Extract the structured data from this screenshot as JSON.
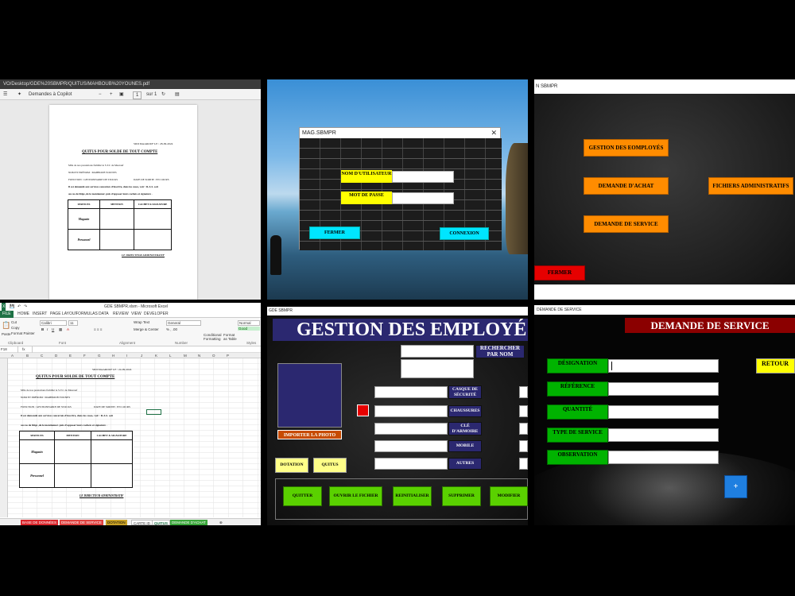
{
  "pdf_viewer": {
    "path": "VO/Desktop/GDE%20SBMPR/QUITUS/MAHBOUB%20YOUNES.pdf",
    "toolbar": {
      "ask_copilot": "Demandes à Copilot",
      "minus": "−",
      "plus": "+",
      "page_num": "1",
      "page_of": "sur 1"
    },
    "document": {
      "location_date": "SIDI MAAROUF LE : 28-09-2024",
      "title": "QUITUS POUR SOLDE DE TOUT COMPTE",
      "intro": "Mlle de nos prestations fiabilité le S.T.C de Maarouf",
      "name_line": "NOM ET PRÉNOM : MAHBOUB YOUNES",
      "function_line": "FONCTION : GESTIONNAIRE DE STOCKS",
      "exit_date": "DATE DE SORTIE : EN COURS",
      "request_line": "Il est demandé aux services concernés d'inscrire, dans les cases, voir : R.A.S. soit",
      "note_line": "au cas de litige ,de le mentionner. puis d'apposer leurs cachets et signature .",
      "table_headers": [
        "SERVICES",
        "MENTION",
        "CACHET & SIGNATURE"
      ],
      "table_rows": [
        "Magasin",
        "Personnel"
      ],
      "signature": "LE DIRECTEUR ADMINISTRATIF"
    }
  },
  "login": {
    "window_title": "MAG.SBMPR",
    "close_glyph": "✕",
    "username_label": "NOM D'UTILISATEUR",
    "password_label": "MOT DE PASSE",
    "close_button": "FERMER",
    "connect_button": "CONNEXION"
  },
  "main_menu": {
    "window_title": "N SBMPR",
    "employees_button": "GESTION DES EOMPLOYÉS",
    "purchase_button": "DEMANDE D'ACHAT",
    "admin_files_button": "FICHIERS ADMINISTRATIFS",
    "service_button": "DEMANDE DE SERVICE",
    "close_button": "FERMER"
  },
  "excel": {
    "window_title": "GDE SBMPR.xlsm - Microsoft Excel",
    "tabs": [
      "FILE",
      "HOME",
      "INSERT",
      "PAGE LAYOUT",
      "FORMULAS",
      "DATA",
      "REVIEW",
      "VIEW",
      "DEVELOPER"
    ],
    "ribbon": {
      "paste": "Paste",
      "cut": "Cut",
      "copy": "Copy",
      "format_painter": "Format Painter",
      "font": "Calibri",
      "font_size": "11",
      "wrap": "Wrap Text",
      "merge": "Merge & Center",
      "number_format": "General",
      "conditional": "Conditional Formatting",
      "format_as_table": "Format as Table",
      "style_normal": "Normal",
      "style_good": "Good",
      "groups": [
        "Clipboard",
        "Font",
        "Alignment",
        "Number",
        "Styles"
      ]
    },
    "name_box": "F18",
    "columns": [
      "A",
      "B",
      "C",
      "D",
      "E",
      "F",
      "G",
      "H",
      "I",
      "J",
      "K",
      "L",
      "M",
      "N",
      "O",
      "P"
    ],
    "document": {
      "location_date": "SIDI MAAROUF LE : 24-09-2024",
      "title": "QUITUS POUR SOLDE DE TOUT COMPTE",
      "intro": "Mlle de nos prestations fiabilité le S.T.C de Maarouf",
      "name_line": "NOM ET PRÉNOM : MAHBOUB YOUNES",
      "function_line": "FONCTION : GESTIONNAIRE DE STOCKS",
      "exit_date": "DATE DE SORTIE : EN COURS",
      "request_line": "Il est demandé aux services concernés d'inscrire, dans les cases, voir : R.A.S. soit",
      "note_line": "au cas de litige ,de le mentionner. puis d'apposer leurs cachets et signature .",
      "table_headers": [
        "SERVICES",
        "MENTION",
        "CACHET & SIGNATURE"
      ],
      "table_rows": [
        "Magasin",
        "Personnel"
      ],
      "signature": "LE DIRECTEUR ADMINISTRATIF"
    },
    "sheet_tabs": [
      {
        "label": "BASE DE DONNÉES",
        "color": "#d9262c"
      },
      {
        "label": "DEMANDE DE SERVICE",
        "color": "#e0413f"
      },
      {
        "label": "DOTATION",
        "color": "#c9a227"
      },
      {
        "label": "CARTE ID",
        "color": "#ffffff"
      },
      {
        "label": "QUITUS",
        "color": "#ffffff"
      },
      {
        "label": "DEMANDE D'ACHAT",
        "color": "#3aa63a"
      }
    ]
  },
  "employees_form": {
    "window_title": "GDE SBMPR",
    "heading": "GESTION DES EMPLOYÉ",
    "search_button": "RECHERCHER PAR NOM",
    "import_photo": "IMPORTER LA PHOTO",
    "equipment_labels": [
      "CASQUE DE SÉCURITÉ",
      "CHAUSSURES",
      "CLÉ D'ARMOIRE",
      "MOBILE",
      "AUTRES"
    ],
    "dotation_button": "DOTATION",
    "quitus_button": "QUITUS",
    "bottom_buttons": [
      "QUITTER",
      "OUVRIR LE FICHIER",
      "REINITIALISER",
      "SUPPRIMER",
      "MODIFIER"
    ]
  },
  "service_request": {
    "window_title": "DEMANDE DE SERVICE",
    "heading": "DEMANDE DE SERVICE",
    "fields": [
      "DÉSIGNATION",
      "RÉFÉRENCE",
      "QUANTITÉ",
      "TYPE DE SERVICE",
      "OBSERVATION"
    ],
    "return_button": "RETOUR",
    "add_button": "+"
  },
  "colors": {
    "yellow_label": "#ffff00",
    "cyan_button": "#00e5ff",
    "orange_button": "#ff8c00",
    "red_button": "#e60000",
    "green_button": "#5ad100",
    "navy_label": "#2b2870",
    "maroon_heading": "#8b0000",
    "green_label": "#00b300",
    "blue_add": "#1f7fe0"
  }
}
